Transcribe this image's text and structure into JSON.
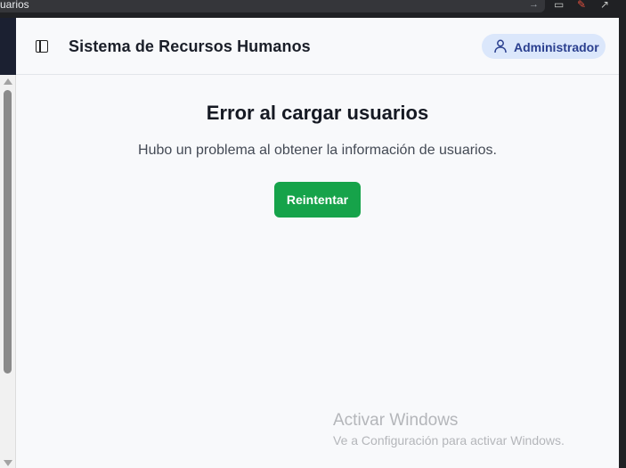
{
  "browser": {
    "url_text": "uarios",
    "icons": [
      "go-arrow-icon",
      "cast-icon",
      "extension-icon",
      "open-external-icon"
    ]
  },
  "header": {
    "title": "Sistema de Recursos Humanos",
    "role_badge": "Administrador",
    "sidebar_toggle_icon": "sidebar-toggle-icon",
    "role_icon": "user-icon"
  },
  "main": {
    "error_title": "Error al cargar usuarios",
    "error_message": "Hubo un problema al obtener la información de usuarios.",
    "retry_label": "Reintentar"
  },
  "watermark": {
    "title": "Activar Windows",
    "subtitle": "Ve a Configuración para activar Windows."
  },
  "colors": {
    "primary_button": "#16a34a",
    "badge_bg": "#dbe7fb",
    "badge_text": "#2a3f8f",
    "page_bg": "#f8f9fb"
  }
}
